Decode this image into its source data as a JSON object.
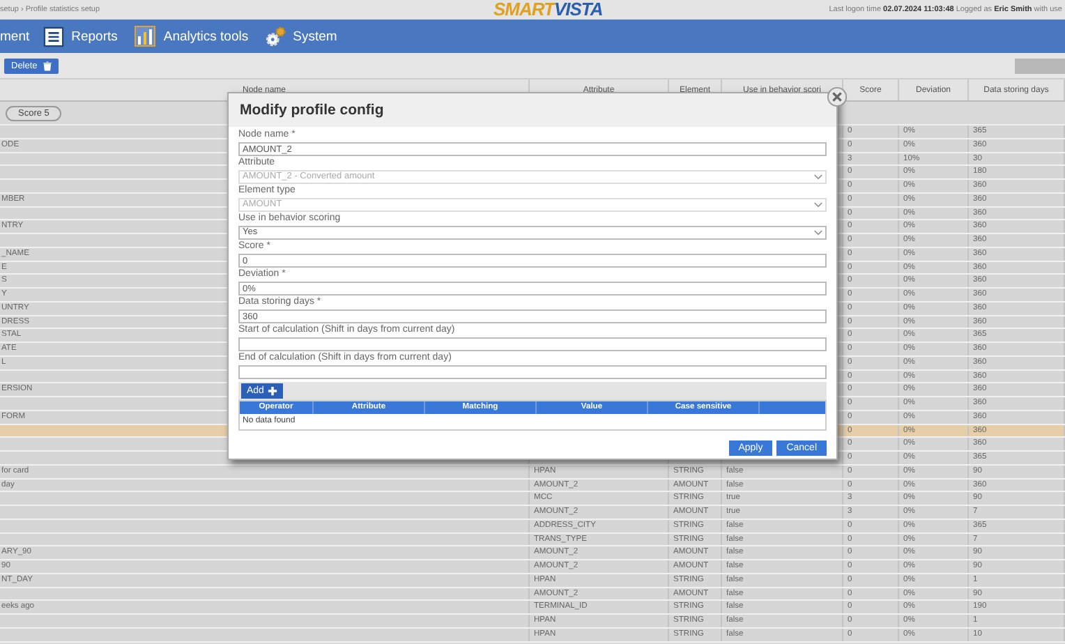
{
  "top_bar": {
    "breadcrumb": "setup › Profile statistics setup",
    "logo": {
      "part_1": "SMART",
      "part_2": "VISTA"
    },
    "login_info": "Last logon time **02.07.2024 11:03:48** Logged as **Eric Smith** with use"
  },
  "nav": [
    {
      "label": "ment"
    },
    {
      "label": "Reports"
    },
    {
      "label": "Analytics tools"
    },
    {
      "label": "System"
    }
  ],
  "toolbar": {
    "delete_button": "Delete",
    "right_button_disabled": true
  },
  "table": {
    "columns": [
      "Node name",
      "Attribute",
      "Element",
      "Use in behavior scori",
      "Score",
      "Deviation",
      "Data storing days"
    ],
    "group_row": {
      "label": "Score 5"
    },
    "rows": [
      {
        "score": "0",
        "deviation": "0%",
        "data_storing_days": "365",
        "selected": false
      },
      {
        "node_name": "ODE",
        "score": "0",
        "deviation": "0%",
        "data_storing_days": "360",
        "selected": false
      },
      {
        "score": "3",
        "deviation": "10%",
        "data_storing_days": "30",
        "selected": false
      },
      {
        "score": "0",
        "deviation": "0%",
        "data_storing_days": "180",
        "selected": false
      },
      {
        "score": "0",
        "deviation": "0%",
        "data_storing_days": "360",
        "selected": false
      },
      {
        "node_name": "MBER",
        "score": "0",
        "deviation": "0%",
        "data_storing_days": "360",
        "selected": false
      },
      {
        "score": "0",
        "deviation": "0%",
        "data_storing_days": "360",
        "selected": false
      },
      {
        "node_name": "NTRY",
        "score": "0",
        "deviation": "0%",
        "data_storing_days": "360",
        "selected": false
      },
      {
        "score": "0",
        "deviation": "0%",
        "data_storing_days": "360",
        "selected": false
      },
      {
        "node_name": "_NAME",
        "score": "0",
        "deviation": "0%",
        "data_storing_days": "360",
        "selected": false
      },
      {
        "node_name": "E",
        "score": "0",
        "deviation": "0%",
        "data_storing_days": "360",
        "selected": false
      },
      {
        "node_name": "S",
        "score": "0",
        "deviation": "0%",
        "data_storing_days": "360",
        "selected": false
      },
      {
        "node_name": "Y",
        "score": "0",
        "deviation": "0%",
        "data_storing_days": "360",
        "selected": false
      },
      {
        "node_name": "UNTRY",
        "score": "0",
        "deviation": "0%",
        "data_storing_days": "360",
        "selected": false
      },
      {
        "node_name": "DRESS",
        "score": "0",
        "deviation": "0%",
        "data_storing_days": "360",
        "selected": false
      },
      {
        "node_name": "STAL",
        "score": "0",
        "deviation": "0%",
        "data_storing_days": "365",
        "selected": false
      },
      {
        "node_name": "ATE",
        "score": "0",
        "deviation": "0%",
        "data_storing_days": "360",
        "selected": false
      },
      {
        "node_name": "L",
        "score": "0",
        "deviation": "0%",
        "data_storing_days": "360",
        "selected": false
      },
      {
        "score": "0",
        "deviation": "0%",
        "data_storing_days": "360",
        "selected": false
      },
      {
        "node_name": "ERSION",
        "score": "0",
        "deviation": "0%",
        "data_storing_days": "360",
        "selected": false
      },
      {
        "score": "0",
        "deviation": "0%",
        "data_storing_days": "360",
        "selected": false
      },
      {
        "node_name": "FORM",
        "score": "0",
        "deviation": "0%",
        "data_storing_days": "360",
        "selected": false
      },
      {
        "score": "0",
        "deviation": "0%",
        "data_storing_days": "360",
        "selected": true
      },
      {
        "score": "0",
        "deviation": "0%",
        "data_storing_days": "360",
        "selected": false
      },
      {
        "score": "0",
        "deviation": "0%",
        "data_storing_days": "365",
        "selected": false
      },
      {
        "node_name": "for card",
        "attribute": "HPAN",
        "element_type": "STRING",
        "use_in_behavior_scoring": "false",
        "score": "0",
        "deviation": "0%",
        "data_storing_days": "90",
        "selected": false
      },
      {
        "node_name": "day",
        "attribute": "AMOUNT_2",
        "element_type": "AMOUNT",
        "use_in_behavior_scoring": "false",
        "score": "0",
        "deviation": "0%",
        "data_storing_days": "360",
        "selected": false
      },
      {
        "attribute": "MCC",
        "element_type": "STRING",
        "use_in_behavior_scoring": "true",
        "score": "3",
        "deviation": "0%",
        "data_storing_days": "90",
        "selected": false
      },
      {
        "attribute": "AMOUNT_2",
        "element_type": "AMOUNT",
        "use_in_behavior_scoring": "true",
        "score": "3",
        "deviation": "0%",
        "data_storing_days": "7",
        "selected": false
      },
      {
        "attribute": "ADDRESS_CITY",
        "element_type": "STRING",
        "use_in_behavior_scoring": "false",
        "score": "0",
        "deviation": "0%",
        "data_storing_days": "365",
        "selected": false
      },
      {
        "attribute": "TRANS_TYPE",
        "element_type": "STRING",
        "use_in_behavior_scoring": "false",
        "score": "0",
        "deviation": "0%",
        "data_storing_days": "7",
        "selected": false
      },
      {
        "node_name": "ARY_90",
        "attribute": "AMOUNT_2",
        "element_type": "AMOUNT",
        "use_in_behavior_scoring": "false",
        "score": "0",
        "deviation": "0%",
        "data_storing_days": "90",
        "selected": false
      },
      {
        "node_name": "90",
        "attribute": "AMOUNT_2",
        "element_type": "AMOUNT",
        "use_in_behavior_scoring": "false",
        "score": "0",
        "deviation": "0%",
        "data_storing_days": "90",
        "selected": false
      },
      {
        "node_name": "NT_DAY",
        "attribute": "HPAN",
        "element_type": "STRING",
        "use_in_behavior_scoring": "false",
        "score": "0",
        "deviation": "0%",
        "data_storing_days": "1",
        "selected": false
      },
      {
        "attribute": "AMOUNT_2",
        "element_type": "AMOUNT",
        "use_in_behavior_scoring": "false",
        "score": "0",
        "deviation": "0%",
        "data_storing_days": "90",
        "selected": false
      },
      {
        "node_name": "eeks ago",
        "attribute": "TERMINAL_ID",
        "element_type": "STRING",
        "use_in_behavior_scoring": "false",
        "score": "0",
        "deviation": "0%",
        "data_storing_days": "190",
        "selected": false
      },
      {
        "attribute": "HPAN",
        "element_type": "STRING",
        "use_in_behavior_scoring": "false",
        "score": "0",
        "deviation": "0%",
        "data_storing_days": "1",
        "selected": false
      },
      {
        "attribute": "HPAN",
        "element_type": "STRING",
        "use_in_behavior_scoring": "false",
        "score": "0",
        "deviation": "0%",
        "data_storing_days": "10",
        "selected": false
      }
    ]
  },
  "dialog": {
    "title": "Modify profile config",
    "fields": [
      {
        "kind": "text",
        "label": "Node name *",
        "value": "AMOUNT_2",
        "disabled": false
      },
      {
        "kind": "select",
        "label": "Attribute",
        "value": "AMOUNT_2 - Converted amount",
        "disabled": true
      },
      {
        "kind": "select",
        "label": "Element type",
        "value": "AMOUNT",
        "disabled": true
      },
      {
        "kind": "select",
        "label": "Use in behavior scoring",
        "value": "Yes",
        "disabled": false
      },
      {
        "kind": "text",
        "label": "Score *",
        "value": "0",
        "disabled": false
      },
      {
        "kind": "text",
        "label": "Deviation *",
        "value": "0%",
        "disabled": false
      },
      {
        "kind": "text",
        "label": "Data storing days *",
        "value": "360",
        "disabled": false
      },
      {
        "kind": "text",
        "label": "Start of calculation (Shift in days from current day)",
        "disabled": false
      },
      {
        "kind": "text",
        "label": "End of calculation (Shift in days from current day)",
        "disabled": false
      }
    ],
    "add_button": "Add",
    "conditions_table": {
      "columns": [
        "Operator",
        "Attribute",
        "Matching",
        "Value",
        "Case sensitive"
      ],
      "empty_message": "No data found"
    },
    "buttons": [
      "Apply",
      "Cancel"
    ]
  }
}
